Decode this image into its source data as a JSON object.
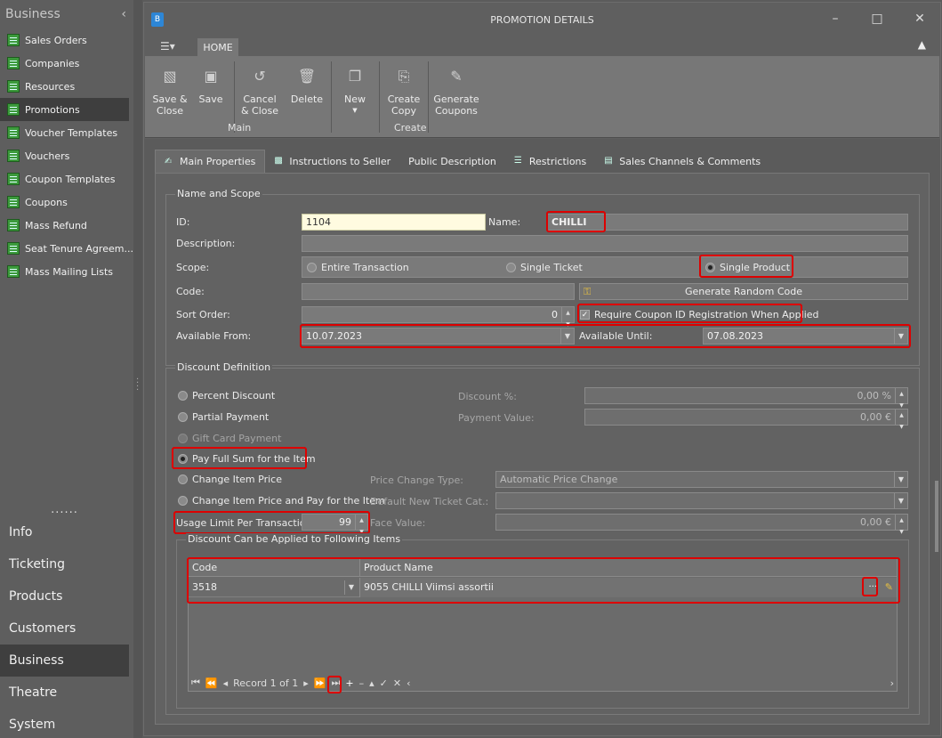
{
  "sidebar": {
    "header": "Business",
    "items": [
      "Sales Orders",
      "Companies",
      "Resources",
      "Promotions",
      "Voucher Templates",
      "Vouchers",
      "Coupon Templates",
      "Coupons",
      "Mass Refund",
      "Seat Tenure Agreem...",
      "Mass Mailing Lists"
    ],
    "dots": "......",
    "categories": [
      "Info",
      "Ticketing",
      "Products",
      "Customers",
      "Business",
      "Theatre",
      "System"
    ]
  },
  "window": {
    "app_icon": "B",
    "title": "PROMOTION DETAILS",
    "ribbon_tab": "HOME",
    "buttons": {
      "save_close": "Save &\nClose",
      "save": "Save",
      "cancel_close": "Cancel\n& Close",
      "delete": "Delete",
      "new": "New",
      "create_copy": "Create\nCopy",
      "generate_coupons": "Generate\nCoupons"
    },
    "groups": {
      "main": "Main",
      "create": "Create"
    }
  },
  "tabs": [
    "Main Properties",
    "Instructions to Seller",
    "Public Description",
    "Restrictions",
    "Sales Channels & Comments"
  ],
  "name_scope": {
    "legend": "Name and Scope",
    "id_label": "ID:",
    "id_value": "1104",
    "name_label": "Name:",
    "name_value": "CHILLI",
    "description_label": "Description:",
    "description_value": "",
    "scope_label": "Scope:",
    "scope_options": [
      "Entire Transaction",
      "Single Ticket",
      "Single Product"
    ],
    "code_label": "Code:",
    "code_value": "",
    "generate_code": "Generate Random Code",
    "sort_label": "Sort Order:",
    "sort_value": "0",
    "require_coupon": "Require Coupon ID Registration When Applied",
    "available_from_label": "Available From:",
    "available_from": "10.07.2023",
    "available_until_label": "Available Until:",
    "available_until": "07.08.2023"
  },
  "discount": {
    "legend": "Discount Definition",
    "options": [
      "Percent Discount",
      "Partial Payment",
      "Gift Card Payment",
      "Pay Full Sum for the Item",
      "Change Item Price",
      "Change Item Price and Pay for the Item"
    ],
    "discount_pct_label": "Discount %:",
    "discount_pct": "0,00 %",
    "payment_value_label": "Payment Value:",
    "payment_value": "0,00 €",
    "price_change_label": "Price Change Type:",
    "price_change": "Automatic Price Change",
    "default_cat_label": "Default New Ticket Cat.:",
    "default_cat": "",
    "face_value_label": "Face Value:",
    "face_value": "0,00 €",
    "usage_limit_label": "Usage Limit Per Transaction:",
    "usage_limit": "99"
  },
  "items": {
    "legend": "Discount Can be Applied to Following Items",
    "col_code": "Code",
    "col_product": "Product Name",
    "row_code": "3518",
    "row_product": "9055 CHILLI Viimsi assortii",
    "ellipsis": "···",
    "record": "Record 1 of 1"
  }
}
